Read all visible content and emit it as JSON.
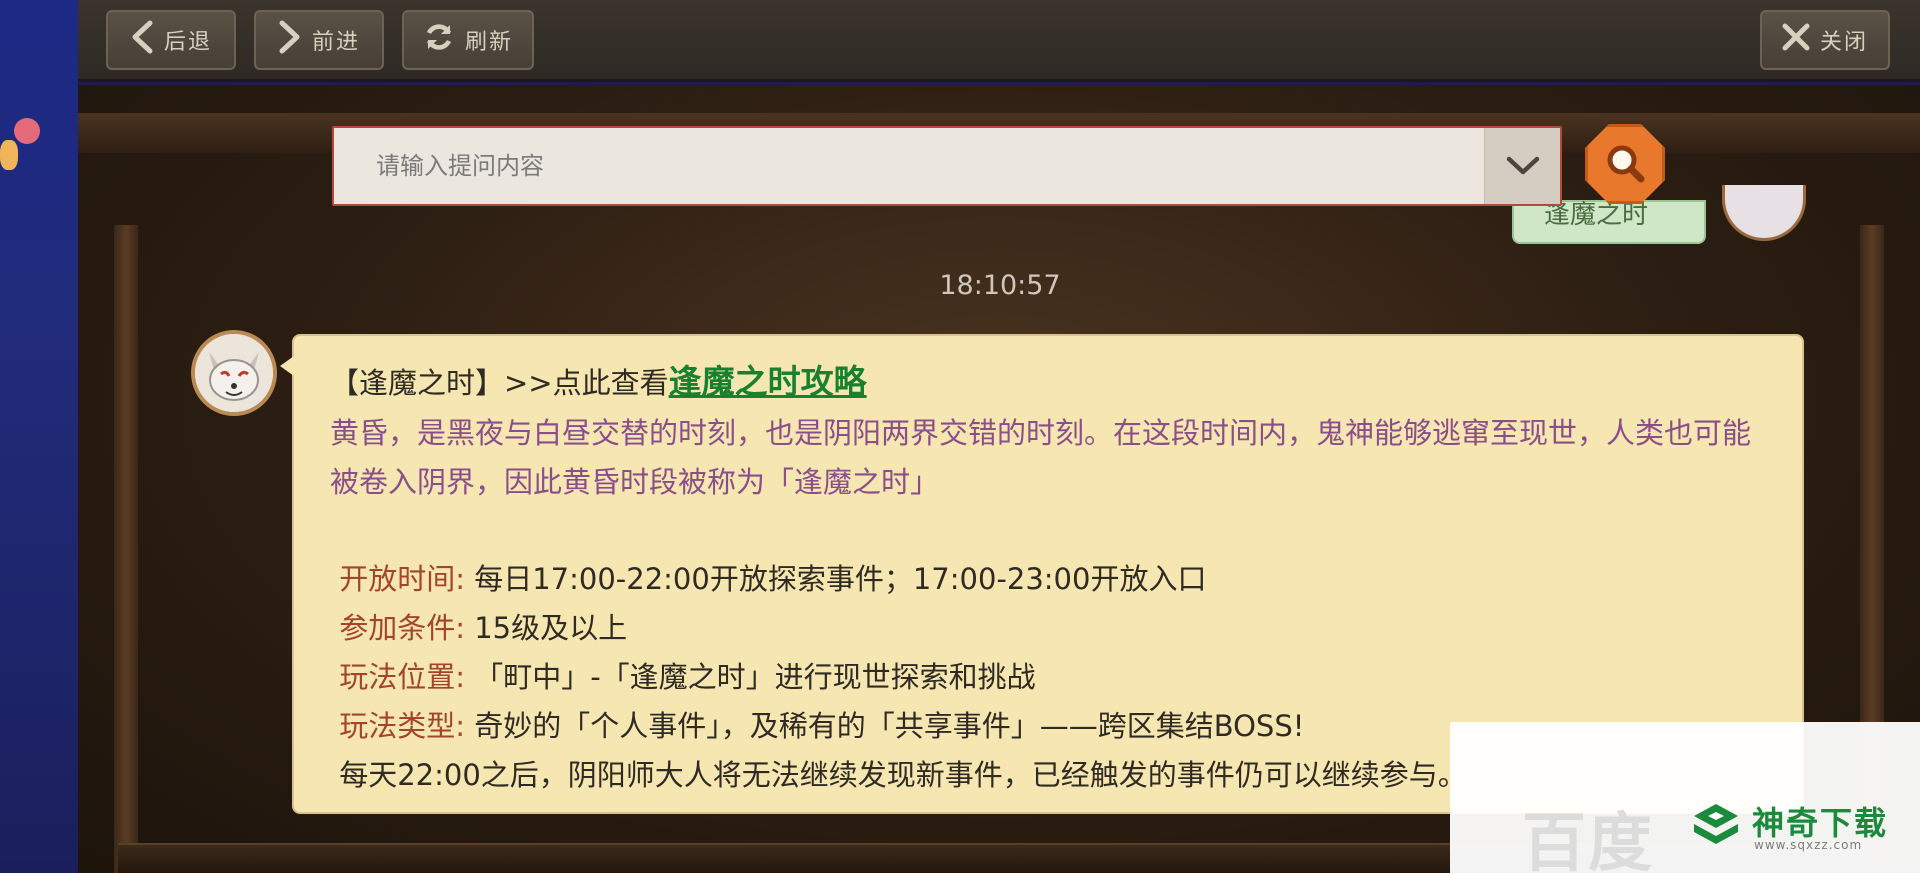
{
  "toolbar": {
    "back_label": "后退",
    "forward_label": "前进",
    "refresh_label": "刷新",
    "close_label": "关闭"
  },
  "search": {
    "placeholder": "请输入提问内容"
  },
  "chat": {
    "user_message": "逢魔之时",
    "timestamp": "18:10:57",
    "answer": {
      "intro_prefix": "【逢魔之时】>>点此查看",
      "guide_link": "逢魔之时攻略",
      "description": "黄昏，是黑夜与白昼交替的时刻，也是阴阳两界交错的时刻。在这段时间内，鬼神能够逃窜至现世，人类也可能被卷入阴界，因此黄昏时段被称为「逢魔之时」",
      "open_time_label": "开放时间:",
      "open_time_value": "每日17:00-22:00开放探索事件；17:00-23:00开放入口",
      "condition_label": "参加条件:",
      "condition_value": "15级及以上",
      "location_label": "玩法位置:",
      "location_value": "「町中」-「逢魔之时」进行现世探索和挑战",
      "type_label": "玩法类型:",
      "type_value": "奇妙的「个人事件」，及稀有的「共享事件」——跨区集结BOSS!",
      "note": "每天22:00之后，阴阳师大人将无法继续发现新事件，已经触发的事件仍可以继续参与。"
    }
  },
  "watermark": {
    "faded_text": "百度",
    "site_name": "神奇下载",
    "site_url": "www.sqxzz.com"
  },
  "colors": {
    "accent_orange": "#e8792c",
    "link_green": "#18812f",
    "label_red": "#a2452c",
    "desc_purple": "#8a4f8a",
    "bubble_bg": "#f6e6b2"
  }
}
